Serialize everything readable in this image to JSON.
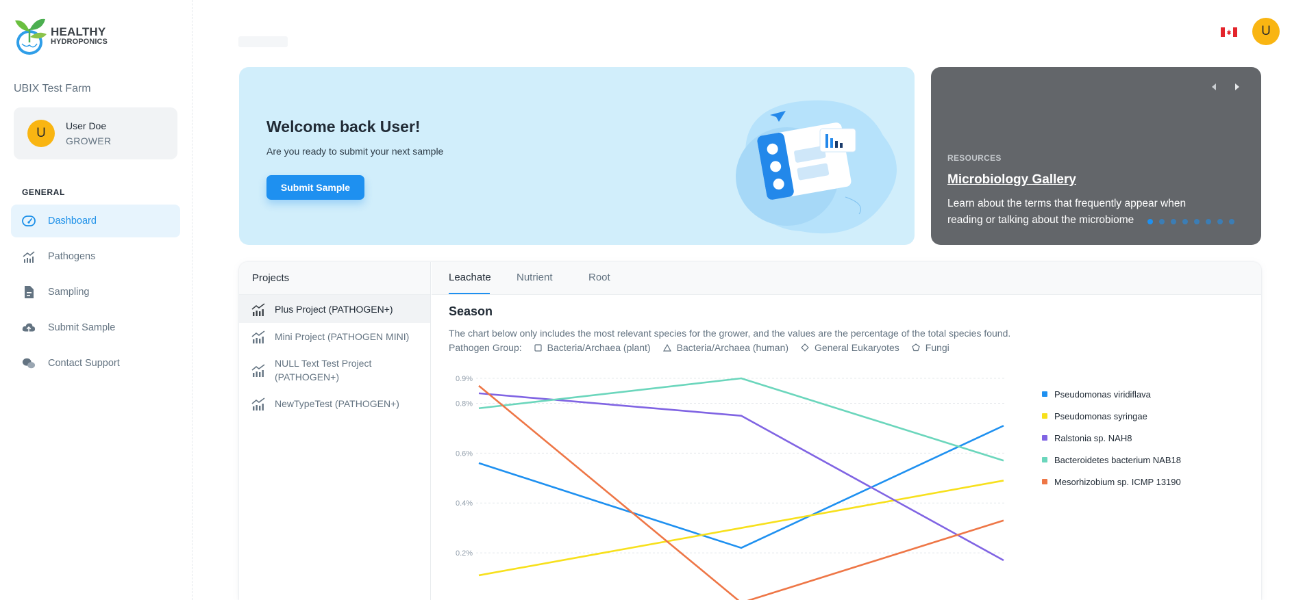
{
  "app": {
    "logo_line1": "HEALTHY",
    "logo_line2": "HYDROPONICS",
    "farm_name": "UBIX Test Farm"
  },
  "user": {
    "initial": "U",
    "name": "User Doe",
    "role": "GROWER"
  },
  "sidebar": {
    "heading": "GENERAL",
    "items": [
      {
        "label": "Dashboard",
        "icon": "dashboard-gauge-icon",
        "active": true
      },
      {
        "label": "Pathogens",
        "icon": "chart-bars-icon"
      },
      {
        "label": "Sampling",
        "icon": "document-icon"
      },
      {
        "label": "Submit Sample",
        "icon": "cloud-upload-icon"
      },
      {
        "label": "Contact Support",
        "icon": "chat-bubbles-icon"
      }
    ]
  },
  "header": {
    "flag": "canada-flag-icon",
    "avatar_initial": "U"
  },
  "welcome": {
    "title": "Welcome back User!",
    "subtitle": "Are you ready to submit your next sample",
    "button": "Submit Sample"
  },
  "resources": {
    "kicker": "RESOURCES",
    "title": "Microbiology Gallery",
    "description": "Learn about the terms that frequently appear when reading or talking about the microbiome",
    "slides": 8,
    "active_slide": 1
  },
  "projects": {
    "heading": "Projects",
    "items": [
      {
        "label": "Plus Project (PATHOGEN+)",
        "active": true
      },
      {
        "label": "Mini Project (PATHOGEN MINI)"
      },
      {
        "label": "NULL Text Test Project (PATHOGEN+)"
      },
      {
        "label": "NewTypeTest (PATHOGEN+)"
      }
    ]
  },
  "tabs": [
    {
      "label": "Leachate",
      "active": true
    },
    {
      "label": "Nutrient"
    },
    {
      "label": "Root"
    }
  ],
  "season": {
    "title": "Season",
    "description": "The chart below only includes the most relevant species for the grower, and the values are the percentage of the total species found.",
    "group_label": "Pathogen Group:",
    "groups": [
      {
        "label": "Bacteria/Archaea (plant)",
        "shape": "square"
      },
      {
        "label": "Bacteria/Archaea (human)",
        "shape": "triangle"
      },
      {
        "label": "General Eukaryotes",
        "shape": "diamond"
      },
      {
        "label": "Fungi",
        "shape": "pentagon"
      }
    ]
  },
  "chart_data": {
    "type": "line",
    "x": [
      0,
      1,
      2
    ],
    "ylim": [
      0,
      0.9
    ],
    "yticks": [
      "0.2%",
      "0.4%",
      "0.6%",
      "0.8%",
      "0.9%"
    ],
    "ytick_values": [
      0.2,
      0.4,
      0.6,
      0.8,
      0.9
    ],
    "grid": true,
    "legend_position": "right",
    "series": [
      {
        "name": "Pseudomonas viridiflava",
        "color": "#1e90f0",
        "values": [
          0.56,
          0.22,
          0.71
        ]
      },
      {
        "name": "Pseudomonas syringae",
        "color": "#f7e01c",
        "values": [
          0.11,
          0.3,
          0.49
        ]
      },
      {
        "name": "Ralstonia sp. NAH8",
        "color": "#8064e3",
        "values": [
          0.84,
          0.75,
          0.17
        ]
      },
      {
        "name": "Bacteroidetes bacterium NAB18",
        "color": "#6bd6bc",
        "values": [
          0.78,
          0.9,
          0.57
        ]
      },
      {
        "name": "Mesorhizobium sp. ICMP 13190",
        "color": "#ee7646",
        "values": [
          0.87,
          0.0,
          0.33
        ]
      }
    ]
  }
}
